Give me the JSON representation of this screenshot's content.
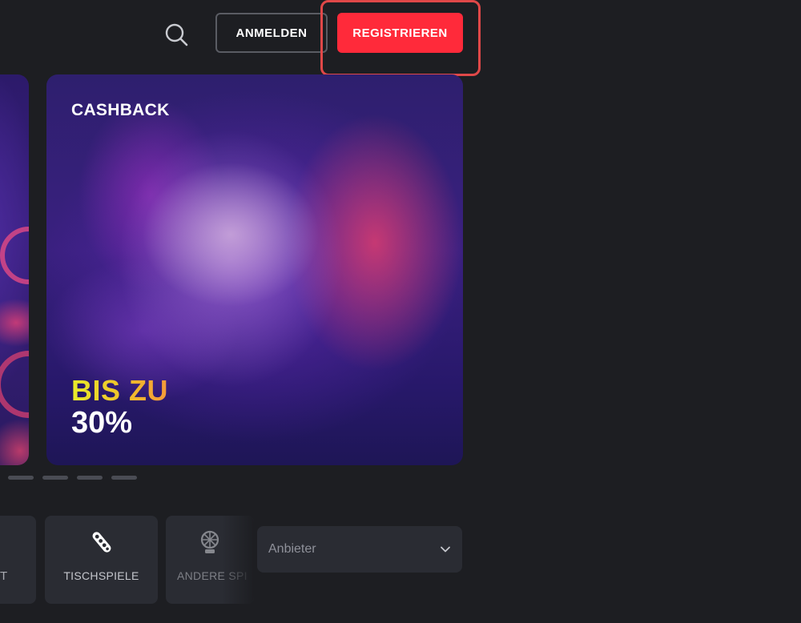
{
  "header": {
    "login_label": "ANMELDEN",
    "register_label": "REGISTRIEREN",
    "search_icon": "search-icon"
  },
  "carousel": {
    "main_slide": {
      "tag": "CASHBACK",
      "line1": "BIS ZU",
      "line2": "30%"
    },
    "dot_count": 4
  },
  "categories": {
    "items": [
      {
        "label": "T",
        "icon": "slot-icon"
      },
      {
        "label": "TISCHSPIELE",
        "icon": "roulette-icon"
      },
      {
        "label": "ANDERE SPI",
        "icon": "wheel-icon"
      }
    ],
    "provider_select": {
      "placeholder": "Anbieter"
    }
  },
  "colors": {
    "background": "#1d1e22",
    "register_bg": "#ff2a3a",
    "highlight_border": "#e04848",
    "card_bg": "#2a2c33"
  }
}
